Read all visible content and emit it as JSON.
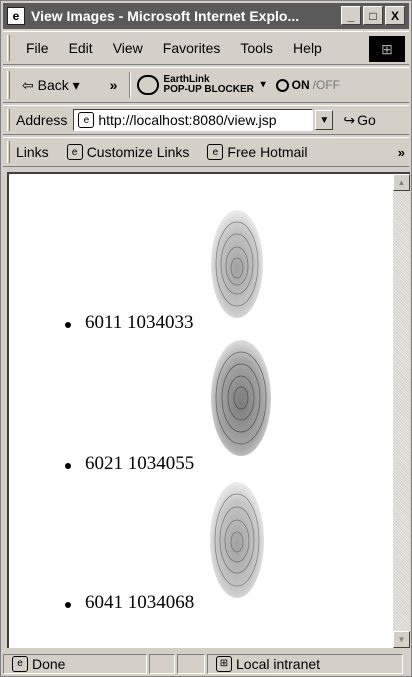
{
  "window": {
    "title": "View Images - Microsoft Internet Explo...",
    "minimize": "_",
    "maximize": "□",
    "close": "X"
  },
  "menu": [
    "File",
    "Edit",
    "View",
    "Favorites",
    "Tools",
    "Help"
  ],
  "toolbar": {
    "back_label": "Back",
    "chevron": "»",
    "earthlink_line1": "EarthLink",
    "earthlink_line2": "POP-UP BLOCKER",
    "on_label": "ON",
    "off_label": "/OFF"
  },
  "address": {
    "label": "Address",
    "url": "http://localhost:8080/view.jsp",
    "go_label": "Go"
  },
  "links": {
    "label": "Links",
    "items": [
      "Customize Links",
      "Free Hotmail"
    ],
    "chevron": "»"
  },
  "page": {
    "images": [
      {
        "caption": "6011 1034033"
      },
      {
        "caption": "6021 1034055"
      },
      {
        "caption": "6041 1034068"
      }
    ]
  },
  "status": {
    "text": "Done",
    "zone": "Local intranet"
  }
}
